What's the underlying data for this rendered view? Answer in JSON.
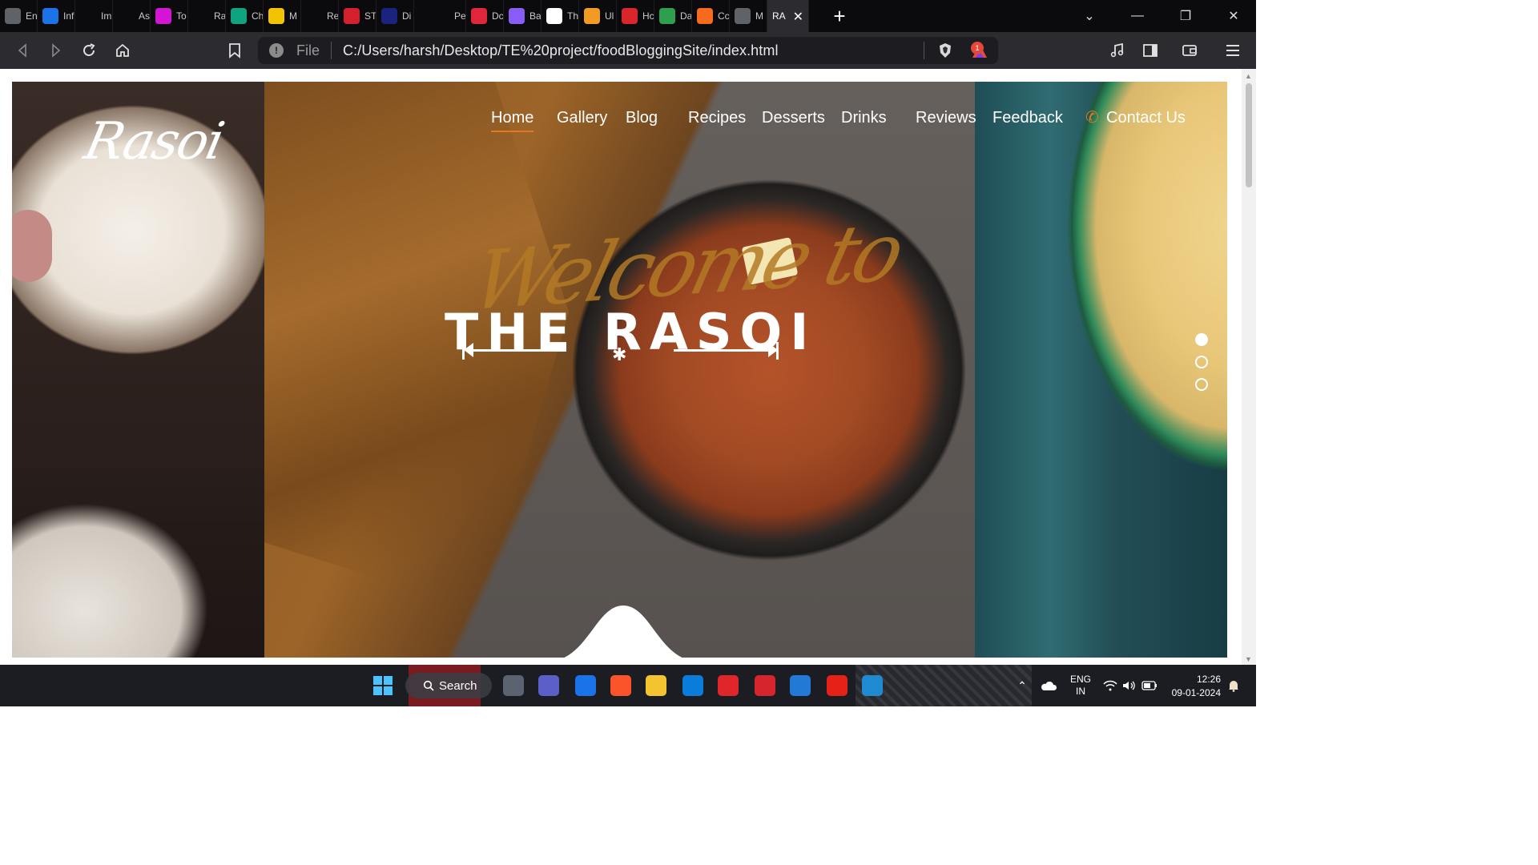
{
  "browser": {
    "tabs": [
      {
        "label": "En",
        "icon": "chrome-globe-icon",
        "color": "#5f6368"
      },
      {
        "label": "Inf",
        "icon": "s-brand-icon",
        "color": "#1a73e8"
      },
      {
        "label": "Im",
        "icon": "search-icon",
        "color": "#0b0b0d"
      },
      {
        "label": "As",
        "icon": "spiral-icon",
        "color": "#0b0b0d"
      },
      {
        "label": "To",
        "icon": "ring-icon",
        "color": "#d416d4"
      },
      {
        "label": "Ra",
        "icon": "gear-icon",
        "color": "#0b0b0d"
      },
      {
        "label": "Ch",
        "icon": "chatgpt-icon",
        "color": "#10a37f"
      },
      {
        "label": "M",
        "icon": "meet-icon",
        "color": "#f2c300"
      },
      {
        "label": "Re",
        "icon": "github-icon",
        "color": "#0b0b0d"
      },
      {
        "label": "ST",
        "icon": "lock-icon",
        "color": "#d3202c"
      },
      {
        "label": "Di",
        "icon": "bh-icon",
        "color": "#1a237e"
      },
      {
        "label": "Pe",
        "icon": "blank-icon",
        "color": "#0b0b0d"
      },
      {
        "label": "Dc",
        "icon": "heart-icon",
        "color": "#e0263a"
      },
      {
        "label": "Ba",
        "icon": "sparkle-icon",
        "color": "#8a5cf6"
      },
      {
        "label": "Th",
        "icon": "r6-icon",
        "color": "#ffffff"
      },
      {
        "label": "Ul",
        "icon": "image-icon",
        "color": "#f29b22"
      },
      {
        "label": "Hc",
        "icon": "z-icon",
        "color": "#d9262c"
      },
      {
        "label": "Da",
        "icon": "mascot-icon",
        "color": "#2e9e4f"
      },
      {
        "label": "Cc",
        "icon": "orange-blocks-icon",
        "color": "#f56a1c"
      },
      {
        "label": "M",
        "icon": "chrome-globe-icon",
        "color": "#5f6368"
      },
      {
        "label": "RA",
        "icon": "",
        "color": "#2b2b30",
        "active": true
      }
    ],
    "new_tab": "+",
    "tab_search": "⌄",
    "minimize": "—",
    "restore": "❐",
    "close": "✕",
    "address": {
      "info": "!",
      "scheme": "File",
      "url": "C:/Users/harsh/Desktop/TE%20project/foodBloggingSite/index.html"
    },
    "rewards_badge": "1"
  },
  "site": {
    "logo": "Rasoi",
    "nav": [
      {
        "label": "Home",
        "active": true
      },
      {
        "label": "Gallery"
      },
      {
        "label": "Blog"
      },
      {
        "label": "Recipes"
      },
      {
        "label": "Desserts"
      },
      {
        "label": "Drinks"
      },
      {
        "label": "Reviews"
      },
      {
        "label": "Feedback"
      },
      {
        "label": "Contact Us",
        "icon": "phone-icon"
      }
    ],
    "hero": {
      "script_text": "Welcome to",
      "title": "THE RASOI",
      "star": "✱",
      "slide_active": 1,
      "slide_count": 3
    },
    "accent_color": "#e3791f"
  },
  "taskbar": {
    "search_label": "Search",
    "apps": [
      {
        "name": "task-view-icon",
        "color": "#5b6270"
      },
      {
        "name": "teams-icon",
        "color": "#5b5fc7"
      },
      {
        "name": "mail-icon",
        "color": "#1a73e8"
      },
      {
        "name": "brave-icon",
        "color": "#fb542b"
      },
      {
        "name": "file-explorer-icon",
        "color": "#f4c430"
      },
      {
        "name": "store-icon",
        "color": "#0a7cd9"
      },
      {
        "name": "youtube-music-icon",
        "color": "#e0262a"
      },
      {
        "name": "office-icon",
        "color": "#d6252c"
      },
      {
        "name": "notepad-icon",
        "color": "#2379d6"
      },
      {
        "name": "youtube-icon",
        "color": "#e62117"
      },
      {
        "name": "vscode-icon",
        "color": "#1f8ad2"
      }
    ],
    "language": {
      "line1": "ENG",
      "line2": "IN"
    },
    "time": "12:26",
    "date": "09-01-2024"
  }
}
